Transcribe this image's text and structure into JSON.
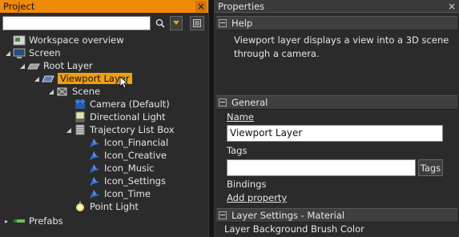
{
  "project": {
    "title": "Project",
    "close": "×",
    "tree": [
      {
        "label": "Workspace overview",
        "icon": "workspace-overview-icon"
      },
      {
        "label": "Screen",
        "icon": "screen-icon"
      },
      {
        "label": "Root Layer",
        "icon": "root-layer-icon"
      },
      {
        "label": "Viewport Layer",
        "icon": "viewport-layer-icon",
        "selected": true
      },
      {
        "label": "Scene",
        "icon": "scene-icon"
      },
      {
        "label": "Camera (Default)",
        "icon": "camera-icon"
      },
      {
        "label": "Directional Light",
        "icon": "directional-light-icon"
      },
      {
        "label": "Trajectory List Box",
        "icon": "trajectory-list-box-icon"
      },
      {
        "label": "Icon_Financial",
        "icon": "node-icon"
      },
      {
        "label": "Icon_Creative",
        "icon": "node-icon"
      },
      {
        "label": "Icon_Music",
        "icon": "node-icon"
      },
      {
        "label": "Icon_Settings",
        "icon": "node-icon"
      },
      {
        "label": "Icon_Time",
        "icon": "node-icon"
      },
      {
        "label": "Point Light",
        "icon": "point-light-icon"
      },
      {
        "label": "Prefabs",
        "icon": "prefabs-icon"
      }
    ]
  },
  "properties": {
    "title": "Properties",
    "close": "×",
    "help": {
      "header": "Help",
      "line1": "Viewport layer displays a view into a 3D scene",
      "line2": "through a camera."
    },
    "general": {
      "header": "General",
      "name_label": "Name",
      "name_value": "Viewport Layer",
      "tags_label": "Tags",
      "tags_value": "",
      "tags_button": "Tags",
      "bindings_label": "Bindings",
      "add_property": "Add property"
    },
    "layer_settings": {
      "header": "Layer Settings - Material",
      "first_item": "Layer Background Brush Color"
    }
  }
}
